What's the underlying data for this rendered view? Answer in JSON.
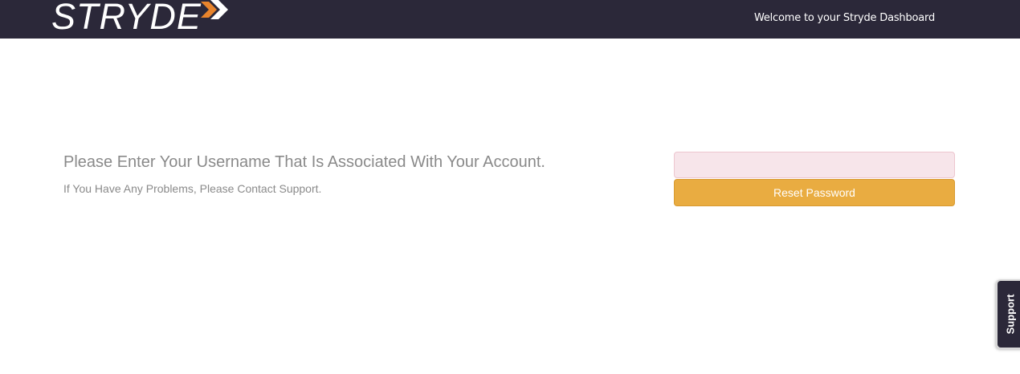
{
  "header": {
    "logo_text": "STRYDE",
    "welcome_text": "Welcome to your Stryde Dashboard",
    "background_color": "#2b2839",
    "logo_arrow_colors": [
      "#ffffff",
      "#e8842c"
    ]
  },
  "main": {
    "heading": "Please Enter Your Username That Is Associated With Your Account.",
    "subheading": "If You Have Any Problems, Please Contact Support.",
    "username_input": {
      "value": "",
      "placeholder": ""
    },
    "reset_button_label": "Reset Password",
    "reset_button_color": "#e9ac41"
  },
  "support_tab": {
    "label": "Support"
  }
}
